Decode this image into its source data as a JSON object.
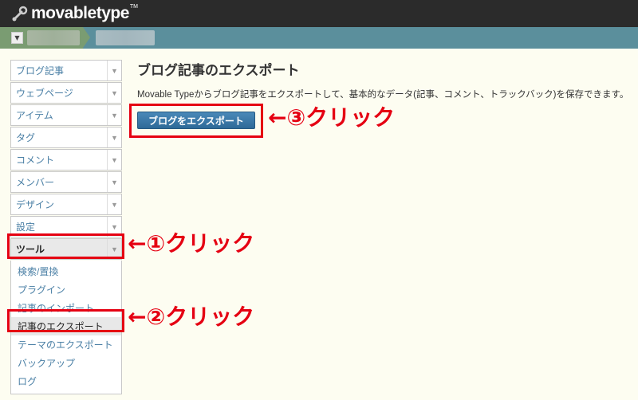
{
  "header": {
    "logo_text": "movabletype",
    "logo_tm": "TM"
  },
  "sidebar": {
    "items": [
      {
        "label": "ブログ記事"
      },
      {
        "label": "ウェブページ"
      },
      {
        "label": "アイテム"
      },
      {
        "label": "タグ"
      },
      {
        "label": "コメント"
      },
      {
        "label": "メンバー"
      },
      {
        "label": "デザイン"
      },
      {
        "label": "設定"
      },
      {
        "label": "ツール"
      }
    ],
    "tools_submenu": [
      {
        "label": "検索/置換"
      },
      {
        "label": "プラグイン"
      },
      {
        "label": "記事のインポート"
      },
      {
        "label": "記事のエクスポート"
      },
      {
        "label": "テーマのエクスポート"
      },
      {
        "label": "バックアップ"
      },
      {
        "label": "ログ"
      }
    ]
  },
  "main": {
    "title": "ブログ記事のエクスポート",
    "description": "Movable Typeからブログ記事をエクスポートして、基本的なデータ(記事、コメント、トラックバック)を保存できます。",
    "export_button": "ブログをエクスポート"
  },
  "annotations": {
    "step1": "←①クリック",
    "step2": "←②クリック",
    "step3": "←③クリック",
    "color": "#e50012"
  }
}
